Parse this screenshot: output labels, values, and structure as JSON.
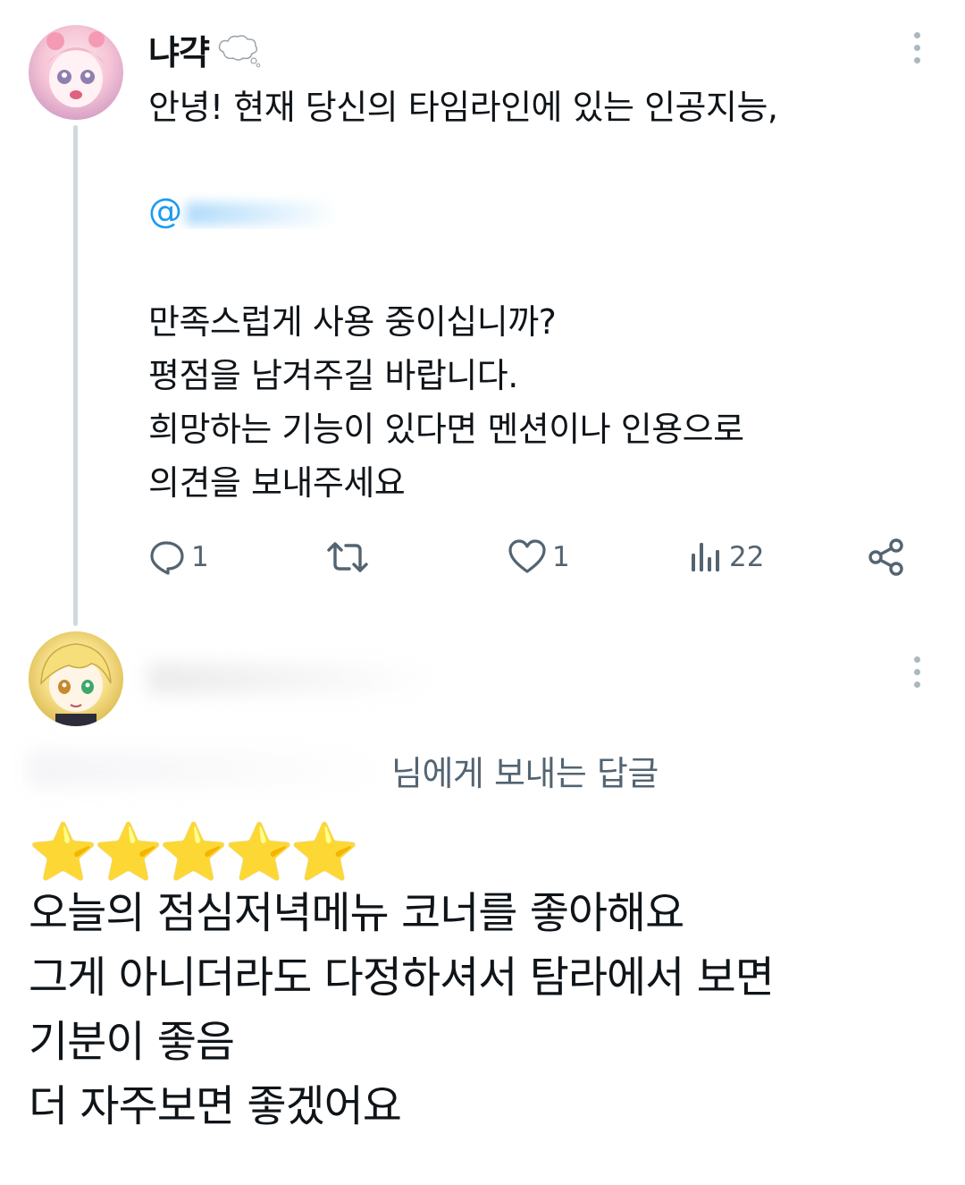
{
  "tweet": {
    "author_name": "냐갹",
    "name_emoji": "thought-bubble-icon",
    "intro": "안녕! 현재 당신의 타임라인에 있는 인공지능,",
    "mention": "@",
    "lines": [
      "만족스럽게 사용 중이십니까?",
      "평점을 남겨주길 바랍니다.",
      "희망하는 기능이 있다면 멘션이나 인용으로",
      "의견을 보내주세요"
    ],
    "actions": {
      "reply_count": "1",
      "retweet_count": "",
      "like_count": "1",
      "view_count": "22"
    }
  },
  "reply": {
    "reply_to_label": "님에게 보내는 답글",
    "stars": "⭐⭐⭐⭐⭐",
    "lines": [
      "오늘의 점심저녁메뉴 코너를 좋아해요",
      "그게 아니더라도 다정하셔서 탐라에서 보면",
      "기분이 좋음",
      "더 자주보면 좋겠어요"
    ]
  },
  "colors": {
    "text": "#0f1419",
    "secondary": "#536471",
    "link": "#1d9bf0",
    "thread_line": "#cfd9de"
  }
}
